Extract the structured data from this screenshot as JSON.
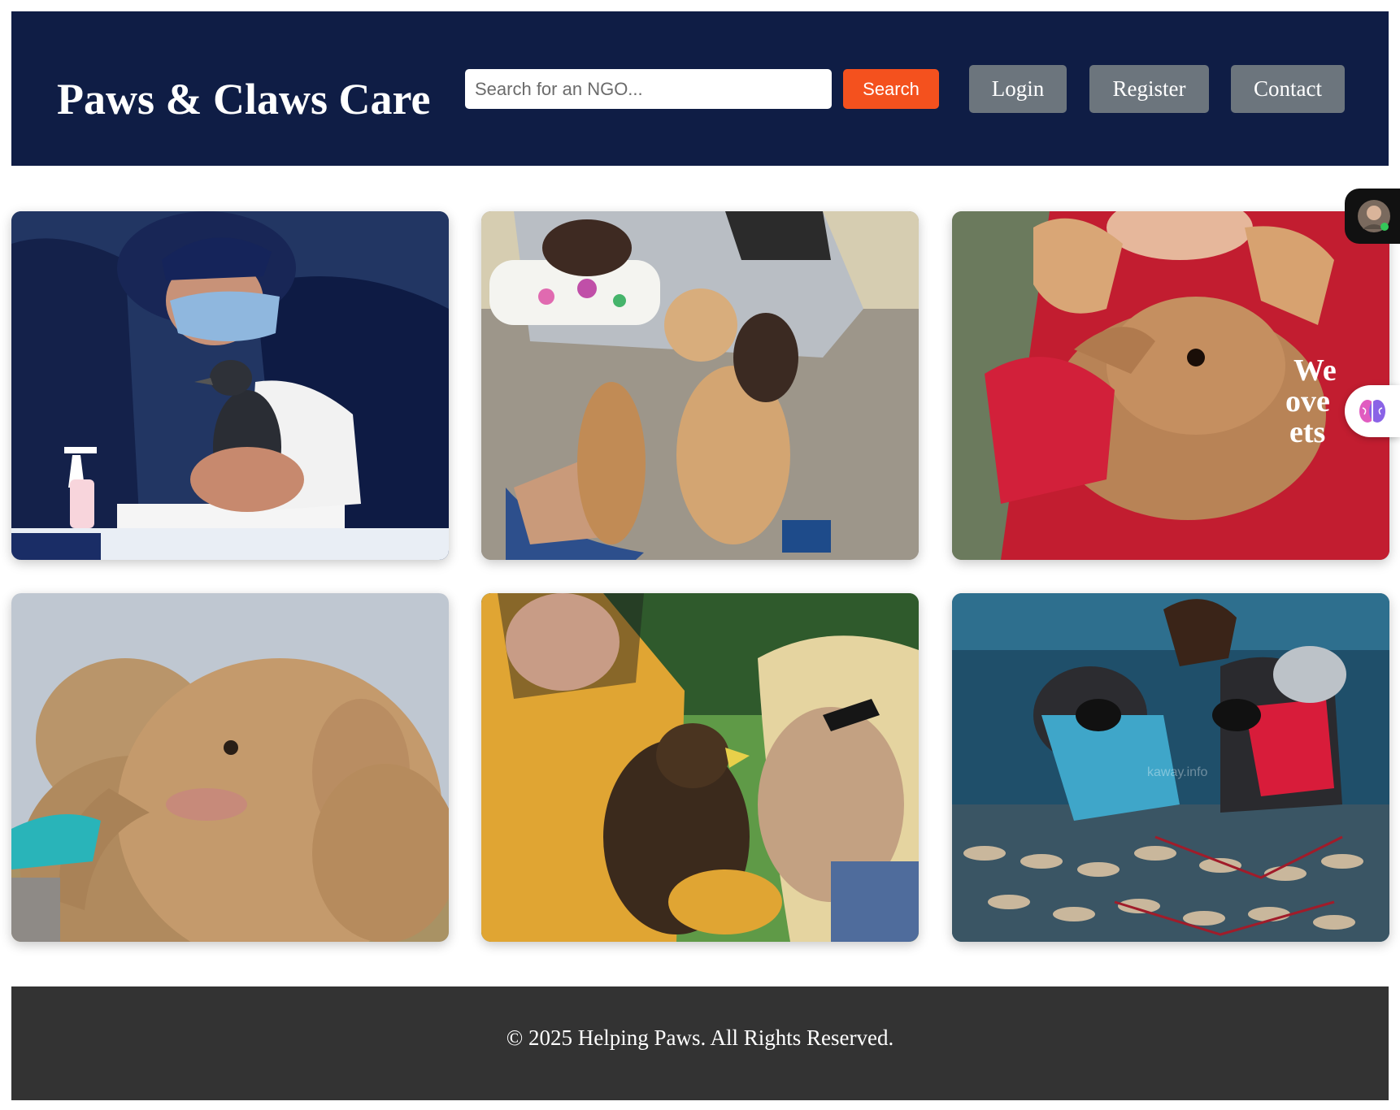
{
  "header": {
    "brand": "Paws & Claws Care",
    "search_placeholder": "Search for an NGO...",
    "search_label": "Search",
    "nav": [
      "Login",
      "Register",
      "Contact"
    ]
  },
  "gallery": [
    {
      "subject": "penguin-chick-care-photo"
    },
    {
      "subject": "puppies-bottle-feeding-photo"
    },
    {
      "subject": "rabbit-hug-photo",
      "shirt_text": [
        "We",
        "ove",
        "ets"
      ]
    },
    {
      "subject": "elephants-photo"
    },
    {
      "subject": "eagle-handling-photo"
    },
    {
      "subject": "coral-divers-photo",
      "watermark": "kaway.info"
    }
  ],
  "footer": {
    "copyright": "© 2025 Helping Paws. All Rights Reserved."
  },
  "colors": {
    "header_bg": "#0f1d45",
    "search_button": "#f4511e",
    "nav_button": "#6c757d",
    "footer_bg": "#333333"
  }
}
